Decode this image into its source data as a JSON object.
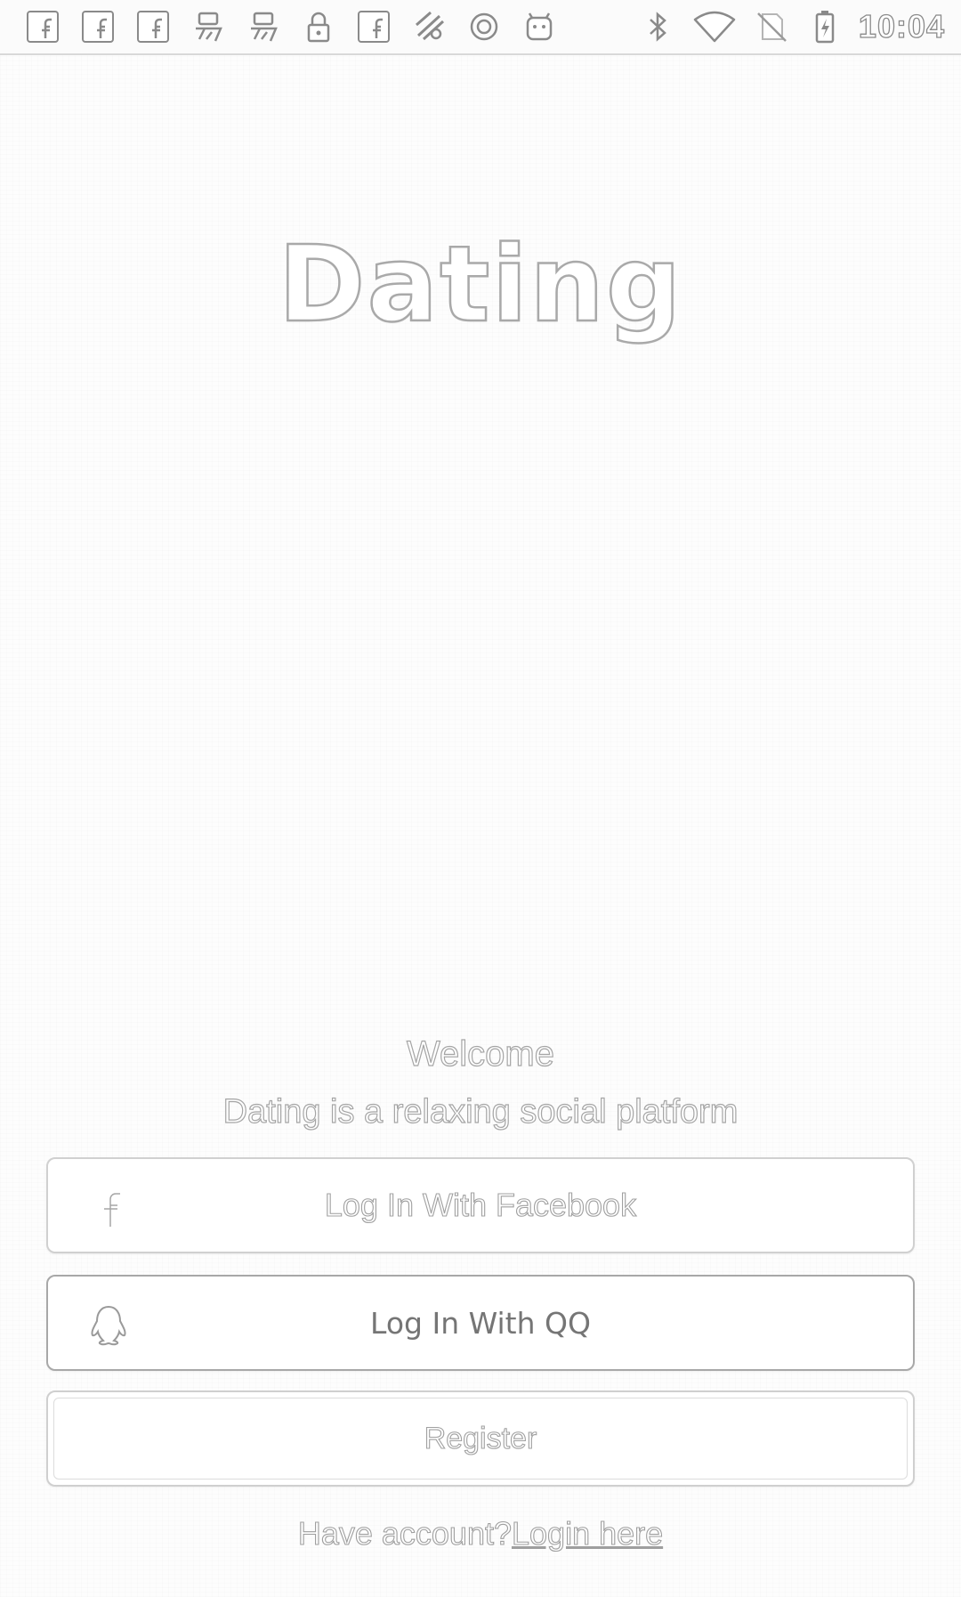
{
  "status_bar": {
    "notification_icons": [
      "facebook-icon",
      "facebook-icon",
      "facebook-icon",
      "yi-icon",
      "yi-icon",
      "lock-icon",
      "facebook-icon",
      "weather-icon",
      "circle-icon",
      "android-icon"
    ],
    "system_icons": [
      "bluetooth-icon",
      "wifi-icon",
      "no-sim-icon",
      "battery-charging-icon"
    ],
    "time": "10:04"
  },
  "app": {
    "title": "Dating"
  },
  "welcome": {
    "heading": "Welcome",
    "tagline": "Dating is a relaxing social platform"
  },
  "buttons": {
    "facebook_label": "Log In With Facebook",
    "qq_label": "Log In With QQ",
    "register_label": "Register"
  },
  "footer": {
    "prompt": "Have account?",
    "login_link": "Login here"
  },
  "colors": {
    "background": "#fdfdfd",
    "outline_gray": "#a9a9a9",
    "qq_text": "#757575"
  }
}
